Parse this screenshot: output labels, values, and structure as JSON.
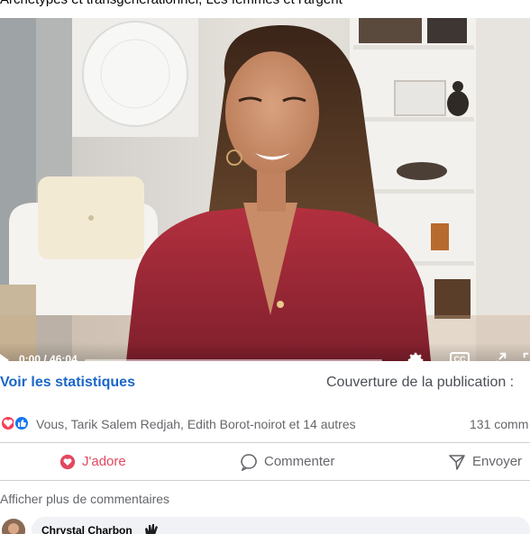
{
  "post": {
    "caption": "Archétypes et transgénérationnel, Les femmes et l'argent"
  },
  "video": {
    "current_time": "0:00",
    "duration": "46:04",
    "progress": 0,
    "controls": {
      "play_icon": "play-icon",
      "settings_icon": "gear-icon",
      "captions_label": "CC",
      "expand_icon": "expand-icon",
      "fullscreen_icon": "fullscreen-icon"
    }
  },
  "stats": {
    "link_label": "Voir les statistiques",
    "coverage_label": "Couverture de la publication :"
  },
  "reactions": {
    "icons": [
      "love-reaction-icon",
      "like-reaction-icon"
    ],
    "colors": {
      "love": "#f33e58",
      "like": "#1877f2"
    },
    "summary": "Vous, Tarik Salem Redjah, Edith Borot-noirot et 14 autres",
    "comment_count": "131 comm"
  },
  "actions": {
    "love_label": "J'adore",
    "comment_label": "Commenter",
    "send_label": "Envoyer",
    "love_color": "#e2485f"
  },
  "comments": {
    "more_label": "Afficher plus de commentaires",
    "first_author": "Chrystal Charbon"
  },
  "colors": {
    "link": "#1a66c9",
    "muted_text": "#65676b",
    "divider": "#ced0d4",
    "bubble": "#f0f2f5"
  }
}
